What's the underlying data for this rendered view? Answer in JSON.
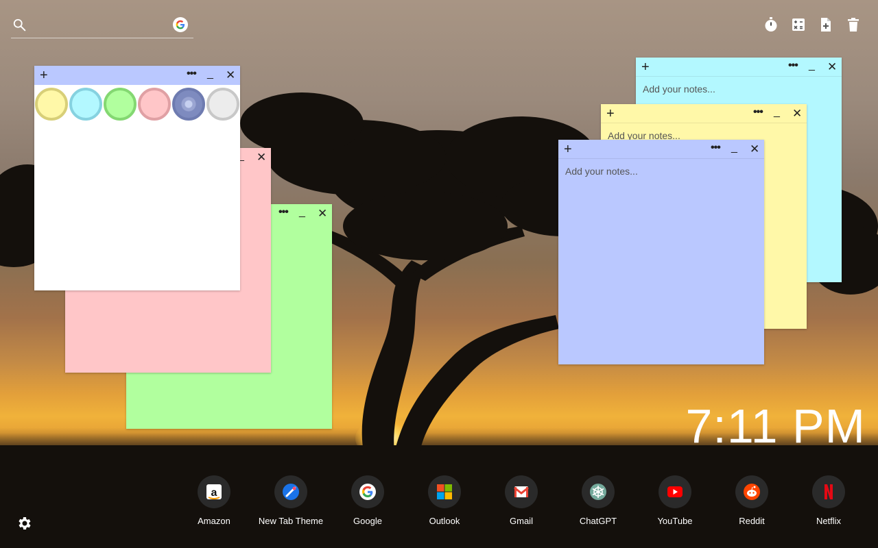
{
  "search": {
    "placeholder": ""
  },
  "toolbar": {
    "icons": [
      "timer-icon",
      "calculator-icon",
      "new-note-icon",
      "trash-icon"
    ]
  },
  "notes": [
    {
      "color": "#b3f8ff",
      "placeholder": "Add your notes..."
    },
    {
      "color": "#fff8a8",
      "placeholder": "Add your notes..."
    },
    {
      "color": "#bac8ff",
      "placeholder": "Add your notes..."
    },
    {
      "color": "#ffc6c8",
      "placeholder": ""
    },
    {
      "color": "#b1ff9e",
      "placeholder": ""
    }
  ],
  "color_picker": {
    "colors": [
      "#fff8a8",
      "#b3f8ff",
      "#b1ff9e",
      "#ffc6c8",
      "#7e8bbf",
      "#ececec"
    ],
    "borders": [
      "#d8cf78",
      "#86d2e0",
      "#84d872",
      "#e0a0a4",
      "#6e7bb0",
      "#c8c8c8"
    ],
    "selected_index": 4
  },
  "clock": {
    "time": "7:11 PM"
  },
  "dock": [
    {
      "label": "Amazon",
      "icon": "amazon-icon"
    },
    {
      "label": "New Tab Theme",
      "icon": "new-tab-theme-icon"
    },
    {
      "label": "Google",
      "icon": "google-icon"
    },
    {
      "label": "Outlook",
      "icon": "outlook-icon"
    },
    {
      "label": "Gmail",
      "icon": "gmail-icon"
    },
    {
      "label": "ChatGPT",
      "icon": "chatgpt-icon"
    },
    {
      "label": "YouTube",
      "icon": "youtube-icon"
    },
    {
      "label": "Reddit",
      "icon": "reddit-icon"
    },
    {
      "label": "Netflix",
      "icon": "netflix-icon"
    }
  ]
}
